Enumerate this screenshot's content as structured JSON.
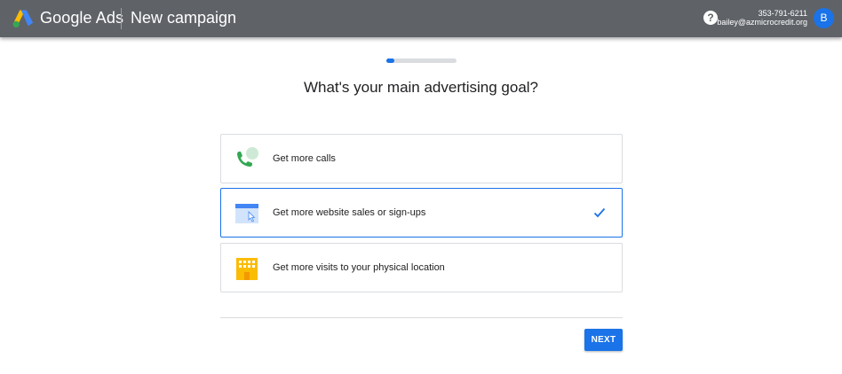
{
  "header": {
    "brand": "Google Ads",
    "page_title": "New campaign",
    "help_icon": "?",
    "account_phone": "353-791-6211",
    "account_email": "bailey@azmicrocredit.org",
    "avatar_initial": "B"
  },
  "progress": {
    "step_fraction": 0.11
  },
  "question": "What's your main advertising goal?",
  "goals": [
    {
      "label": "Get more calls",
      "icon": "phone-icon",
      "selected": false
    },
    {
      "label": "Get more website sales or sign-ups",
      "icon": "website-icon",
      "selected": true
    },
    {
      "label": "Get more visits to your physical location",
      "icon": "storefront-icon",
      "selected": false
    }
  ],
  "next_button": "NEXT",
  "colors": {
    "topbar": "#5f6368",
    "accent": "#1a73e8",
    "call_green": "#34a853",
    "store_yellow": "#fbbc04"
  }
}
